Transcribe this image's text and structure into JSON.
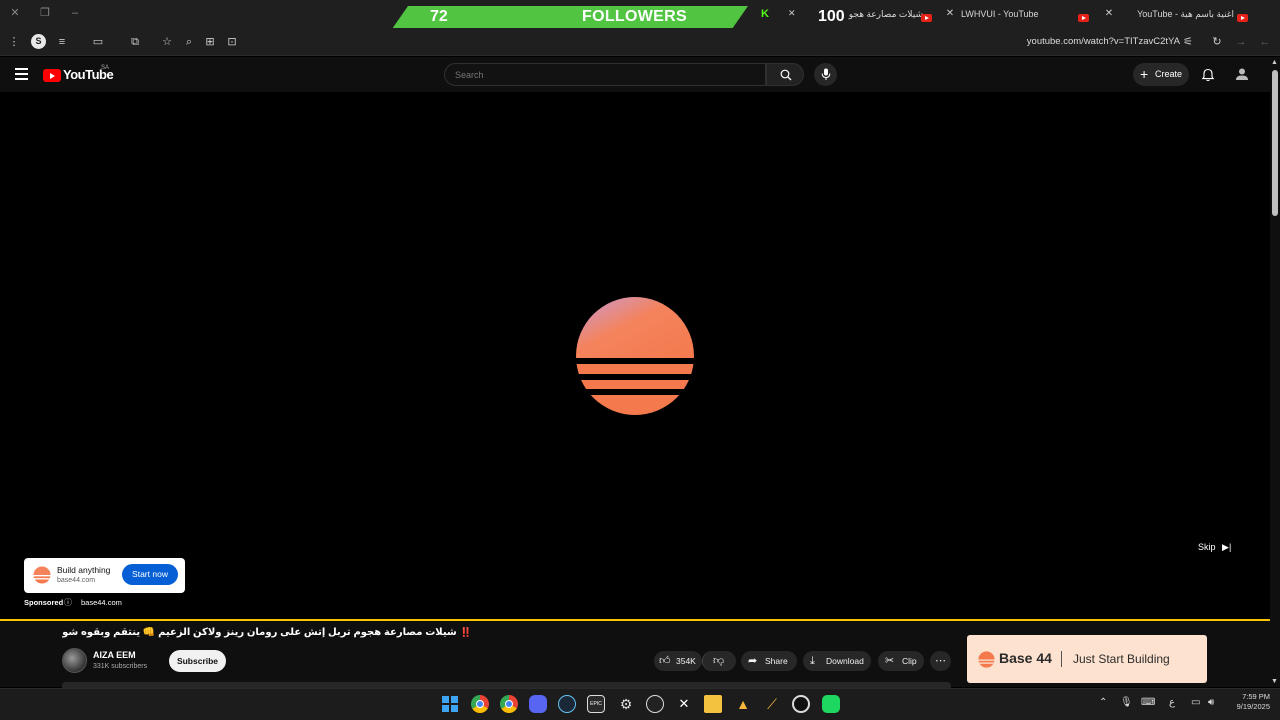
{
  "browser": {
    "tabs": [
      {
        "label": "شيلات مصارعة هجو"
      },
      {
        "label": "LWHVUI - YouTube"
      },
      {
        "label": "YouTube - اغنية باسم هبة"
      }
    ],
    "address": "youtube.com/watch?v=TITzavC2tYA"
  },
  "overlay": {
    "followers_count": "72",
    "followers_label": "FOLLOWERS",
    "goal": "100"
  },
  "youtube": {
    "logo_text": "YouTube",
    "region": "SA",
    "search_placeholder": "Search",
    "create_label": "Create"
  },
  "ad": {
    "skip_label": "Skip",
    "card_title": "Build anything",
    "card_domain": "base44.com",
    "card_button": "Start now",
    "sponsored": "Sponsored",
    "sponsored_domain": "base44.com",
    "banner_brand": "Base 44",
    "banner_slogan": "Just Start Building"
  },
  "video": {
    "title": "‼️ شيلات مصارعة هجوم تربل إتش على رومان رينز ولاكن الزعيم 👊 ينتقم وبقوه شوفو وش سوا فيه 👆",
    "channel_name": "AIZA EEM",
    "subscribers": "331K subscribers",
    "subscribe_label": "Subscribe",
    "likes": "354K",
    "share_label": "Share",
    "download_label": "Download",
    "clip_label": "Clip"
  },
  "taskbar": {
    "lang": "ع",
    "time": "7:59 PM",
    "date": "9/19/2025"
  },
  "colors": {
    "follower_green": "#51c541",
    "yt_red": "#e62117",
    "progress_yellow": "#f7c600",
    "ad_orange": "#f47a4e",
    "cta_blue": "#065fd4"
  }
}
